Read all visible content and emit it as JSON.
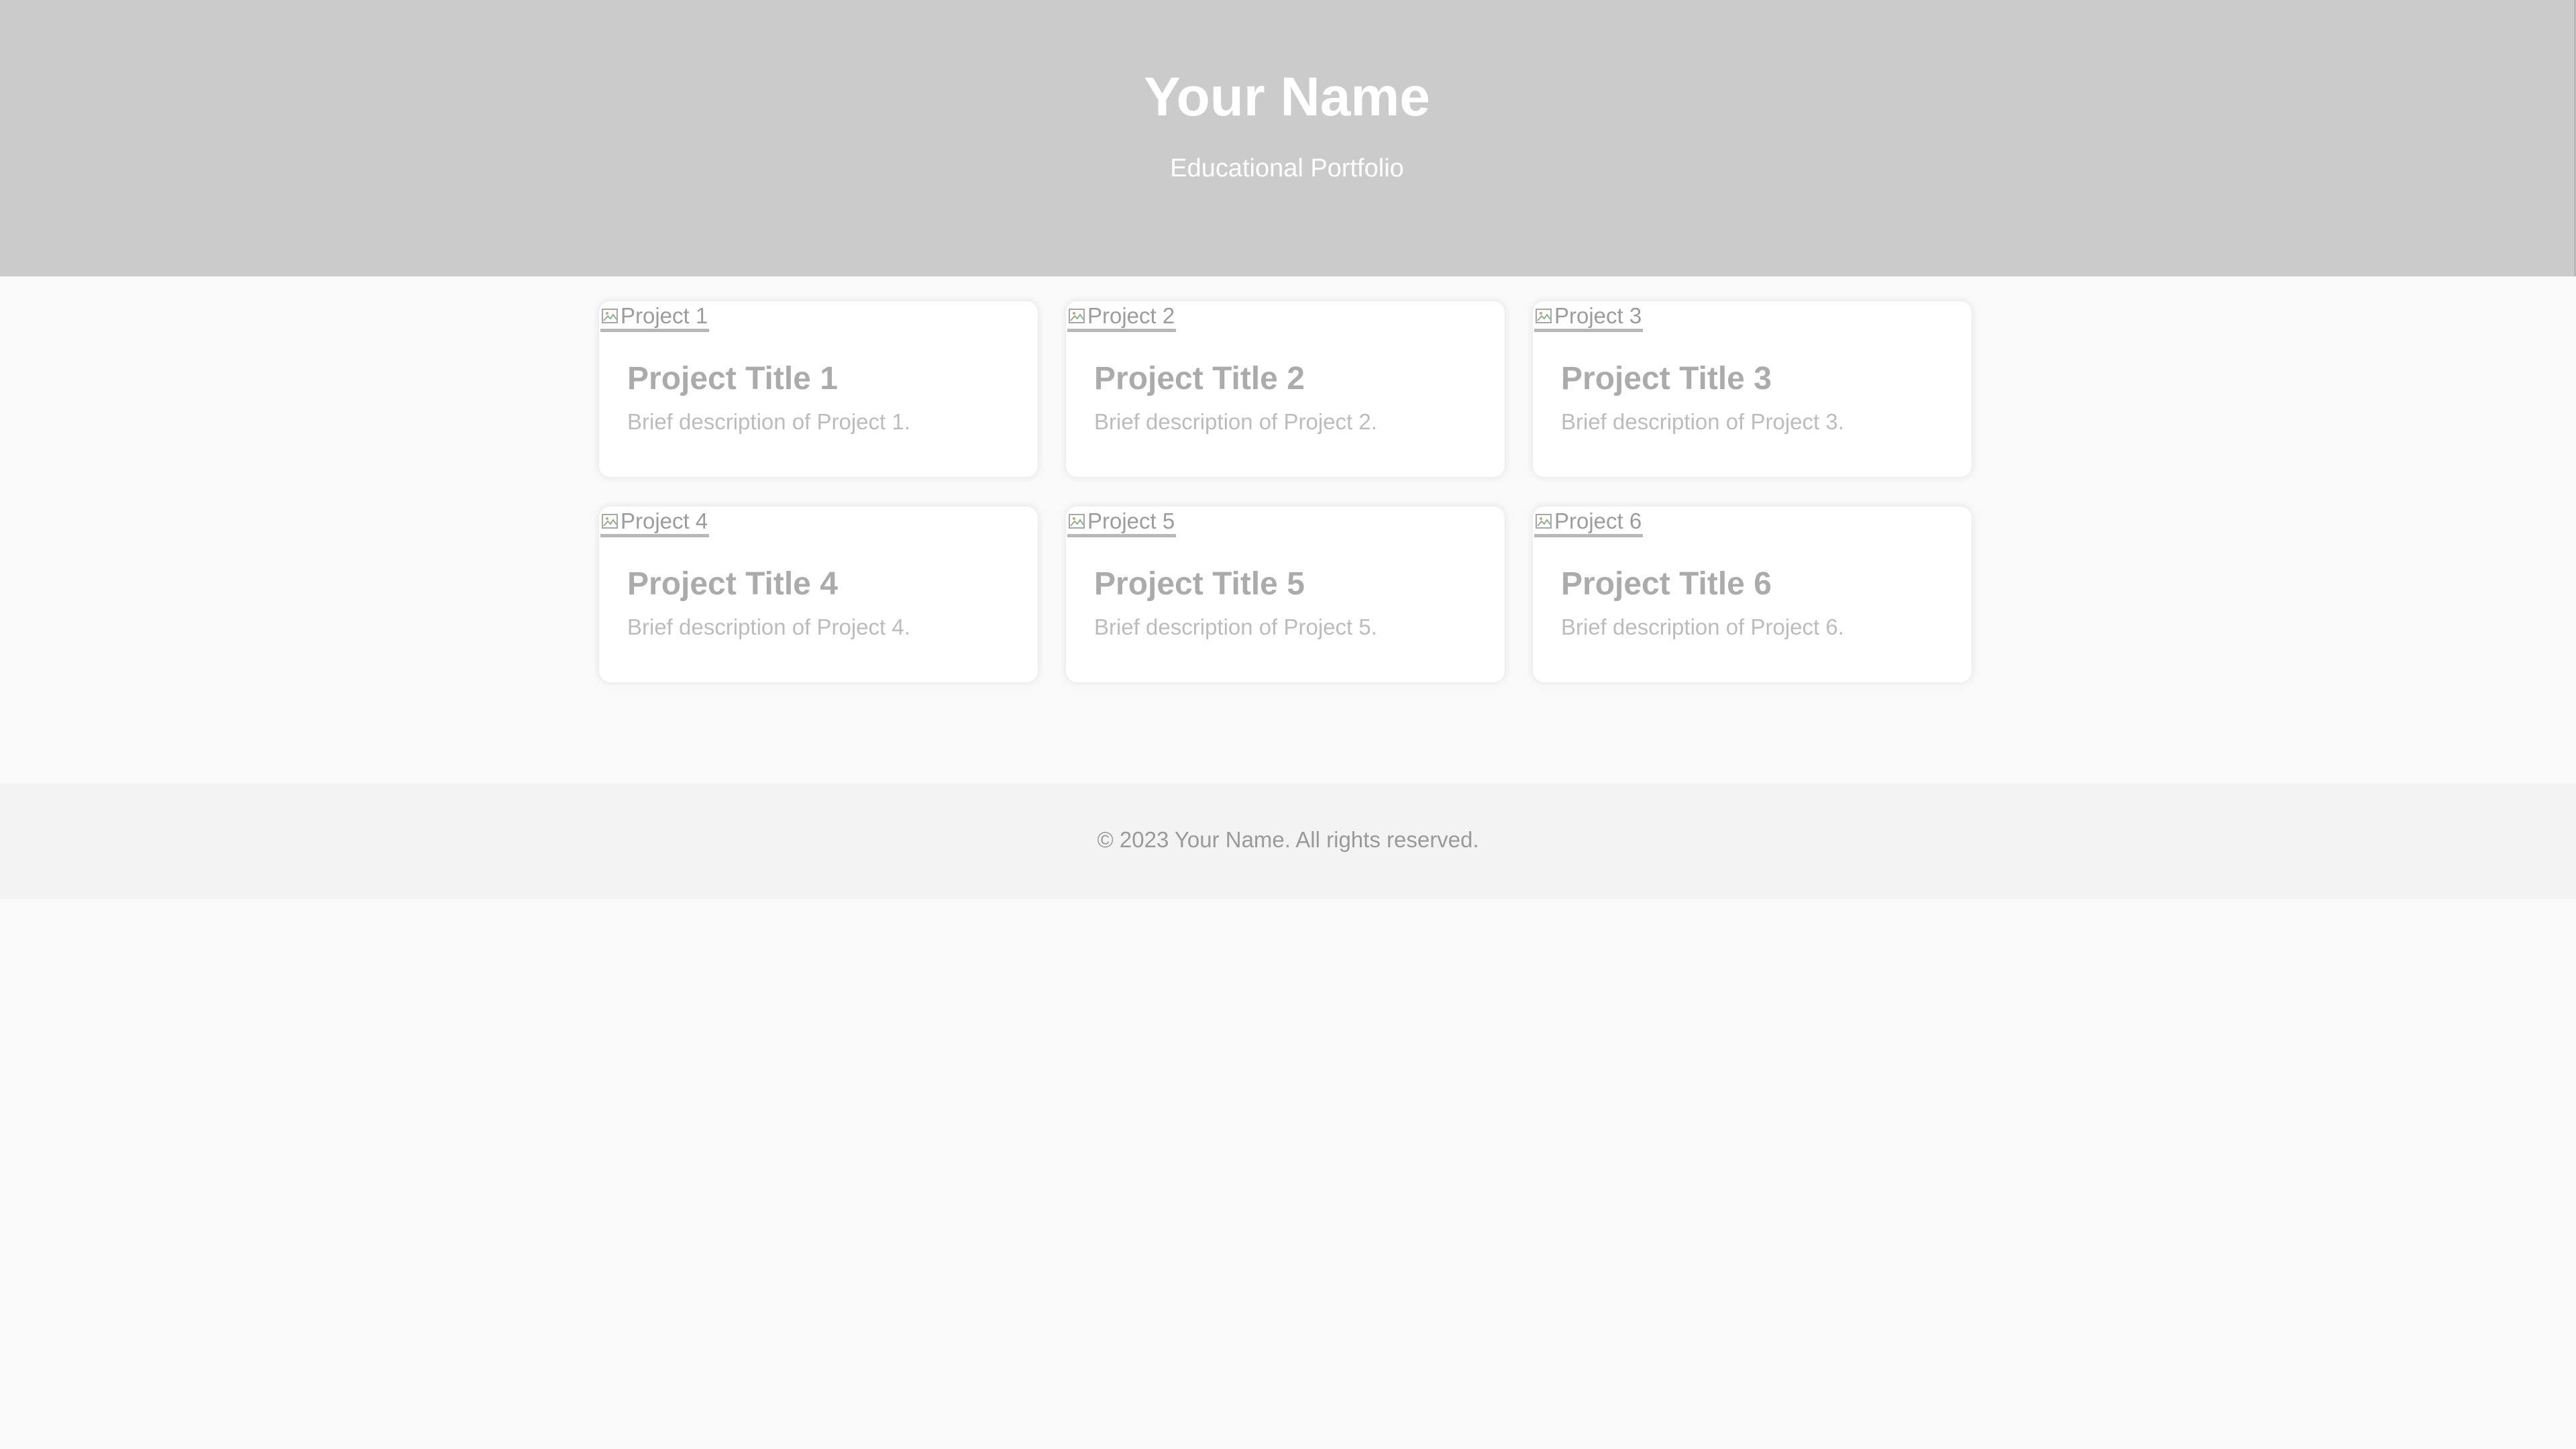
{
  "header": {
    "title": "Your Name",
    "subtitle": "Educational Portfolio"
  },
  "projects": [
    {
      "image_alt": "Project 1",
      "title": "Project Title 1",
      "description": "Brief description of Project 1."
    },
    {
      "image_alt": "Project 2",
      "title": "Project Title 2",
      "description": "Brief description of Project 2."
    },
    {
      "image_alt": "Project 3",
      "title": "Project Title 3",
      "description": "Brief description of Project 3."
    },
    {
      "image_alt": "Project 4",
      "title": "Project Title 4",
      "description": "Brief description of Project 4."
    },
    {
      "image_alt": "Project 5",
      "title": "Project Title 5",
      "description": "Brief description of Project 5."
    },
    {
      "image_alt": "Project 6",
      "title": "Project Title 6",
      "description": "Brief description of Project 6."
    }
  ],
  "footer": {
    "copyright": "© 2023 Your Name. All rights reserved."
  },
  "icons": {
    "broken_image": "broken-image-icon"
  },
  "colors": {
    "header_bg": "#cbcbcb",
    "page_bg": "#f9f9f9",
    "footer_bg": "#f3f3f3"
  }
}
